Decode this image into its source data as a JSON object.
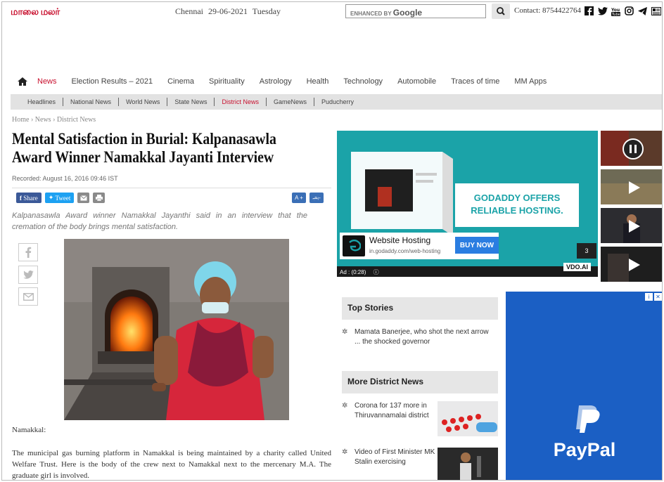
{
  "header": {
    "logo": "மாலை மலர்",
    "city": "Chennai",
    "date": "29-06-2021",
    "day": "Tuesday",
    "search_prefix": "ENHANCED BY",
    "search_brand": "Google",
    "contact_label": "Contact:",
    "contact_number": "8754422764",
    "social_icons": [
      "facebook-icon",
      "twitter-icon",
      "youtube-icon",
      "instagram-icon",
      "telegram-icon",
      "newsletter-icon"
    ]
  },
  "mainnav": {
    "items": [
      "News",
      "Election Results – 2021",
      "Cinema",
      "Spirituality",
      "Astrology",
      "Health",
      "Technology",
      "Automobile",
      "Traces of time",
      "MM Apps"
    ],
    "active": "News"
  },
  "subnav": {
    "items": [
      "Headlines",
      "National News",
      "World News",
      "State News",
      "District News",
      "GameNews",
      "Puducherry"
    ],
    "active": "District News"
  },
  "breadcrumb": {
    "home": "Home",
    "sep": "›",
    "news": "News",
    "district": "District News"
  },
  "article": {
    "headline": "Mental Satisfaction in Burial: Kalpanasawla Award Winner Namakkal Jayanti Interview",
    "recorded": "Recorded: August 16, 2016 09:46 IST",
    "share_fb": "Share",
    "share_tw": "Tweet",
    "font_plus": "A +",
    "font_minus": "அ-",
    "summary": "Kalpanasawla Award winner Namakkal Jayanthi said in an interview that the cremation of the body brings mental satisfaction.",
    "place": "Namakkal:",
    "body": "The municipal gas burning platform in Namakkal is being maintained by a charity called United Welfare Trust. Here is the body of the crew next to Namakkal next to the mercenary M.A. The graduate girl is involved."
  },
  "ad": {
    "headline": "GODADDY OFFERS RELIABLE HOSTING.",
    "title": "Website Hosting",
    "url": "in.godaddy.com/web-hosting",
    "button": "BUY NOW",
    "count": "3",
    "footer": "Ad : (0:28)",
    "brand": "VDO.AI"
  },
  "top_stories": {
    "title": "Top Stories",
    "items": [
      "Mamata Banerjee, who shot the next arrow ... the shocked governor"
    ]
  },
  "more_district": {
    "title": "More District News",
    "items": [
      "Corona for 137 more in Thiruvannamalai district",
      "Video of First Minister MK Stalin exercising"
    ]
  },
  "paypal": {
    "brand": "PayPal"
  },
  "colors": {
    "accent": "#c8102e",
    "ad_teal": "#1ba3a8",
    "paypal_blue": "#1b5fc4"
  }
}
